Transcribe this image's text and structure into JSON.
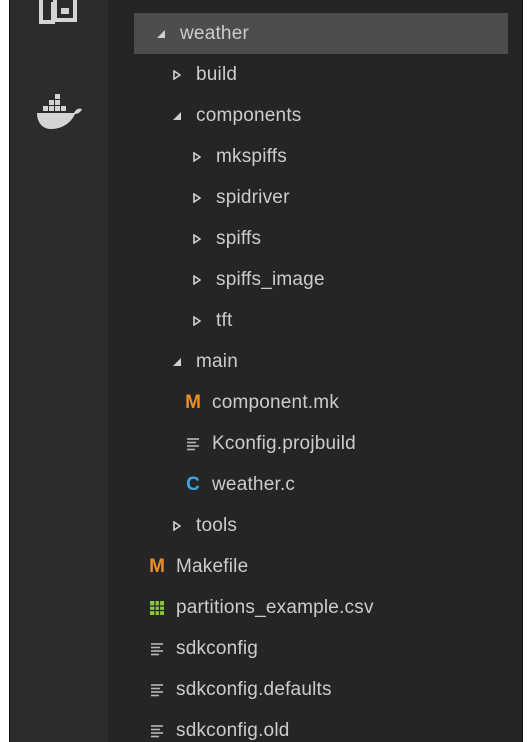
{
  "activity_bar": {
    "icons": [
      "explorer-icon",
      "docker-icon"
    ]
  },
  "explorer": {
    "items": [
      {
        "label": "weather",
        "kind": "folder",
        "expanded": true,
        "depth": 0,
        "selected": true
      },
      {
        "label": "build",
        "kind": "folder",
        "expanded": false,
        "depth": 1
      },
      {
        "label": "components",
        "kind": "folder",
        "expanded": true,
        "depth": 1
      },
      {
        "label": "mkspiffs",
        "kind": "folder",
        "expanded": false,
        "depth": 2
      },
      {
        "label": "spidriver",
        "kind": "folder",
        "expanded": false,
        "depth": 2
      },
      {
        "label": "spiffs",
        "kind": "folder",
        "expanded": false,
        "depth": 2
      },
      {
        "label": "spiffs_image",
        "kind": "folder",
        "expanded": false,
        "depth": 2
      },
      {
        "label": "tft",
        "kind": "folder",
        "expanded": false,
        "depth": 2
      },
      {
        "label": "main",
        "kind": "folder",
        "expanded": true,
        "depth": 1
      },
      {
        "label": "component.mk",
        "kind": "file",
        "icon": "makefile-icon",
        "depth": 1
      },
      {
        "label": "Kconfig.projbuild",
        "kind": "file",
        "icon": "text-file-icon",
        "depth": 1
      },
      {
        "label": "weather.c",
        "kind": "file",
        "icon": "c-file-icon",
        "depth": 1
      },
      {
        "label": "tools",
        "kind": "folder",
        "expanded": false,
        "depth": 1
      },
      {
        "label": "Makefile",
        "kind": "file",
        "icon": "makefile-icon",
        "depth": 0
      },
      {
        "label": "partitions_example.csv",
        "kind": "file",
        "icon": "csv-file-icon",
        "depth": 0
      },
      {
        "label": "sdkconfig",
        "kind": "file",
        "icon": "text-file-icon",
        "depth": 0
      },
      {
        "label": "sdkconfig.defaults",
        "kind": "file",
        "icon": "text-file-icon",
        "depth": 0
      },
      {
        "label": "sdkconfig.old",
        "kind": "file",
        "icon": "text-file-icon",
        "depth": 0
      }
    ]
  },
  "colors": {
    "makefile": "#f08c28",
    "c_file": "#3ea7e0",
    "csv_file": "#8cc63f",
    "selection": "#4d4d4d"
  }
}
